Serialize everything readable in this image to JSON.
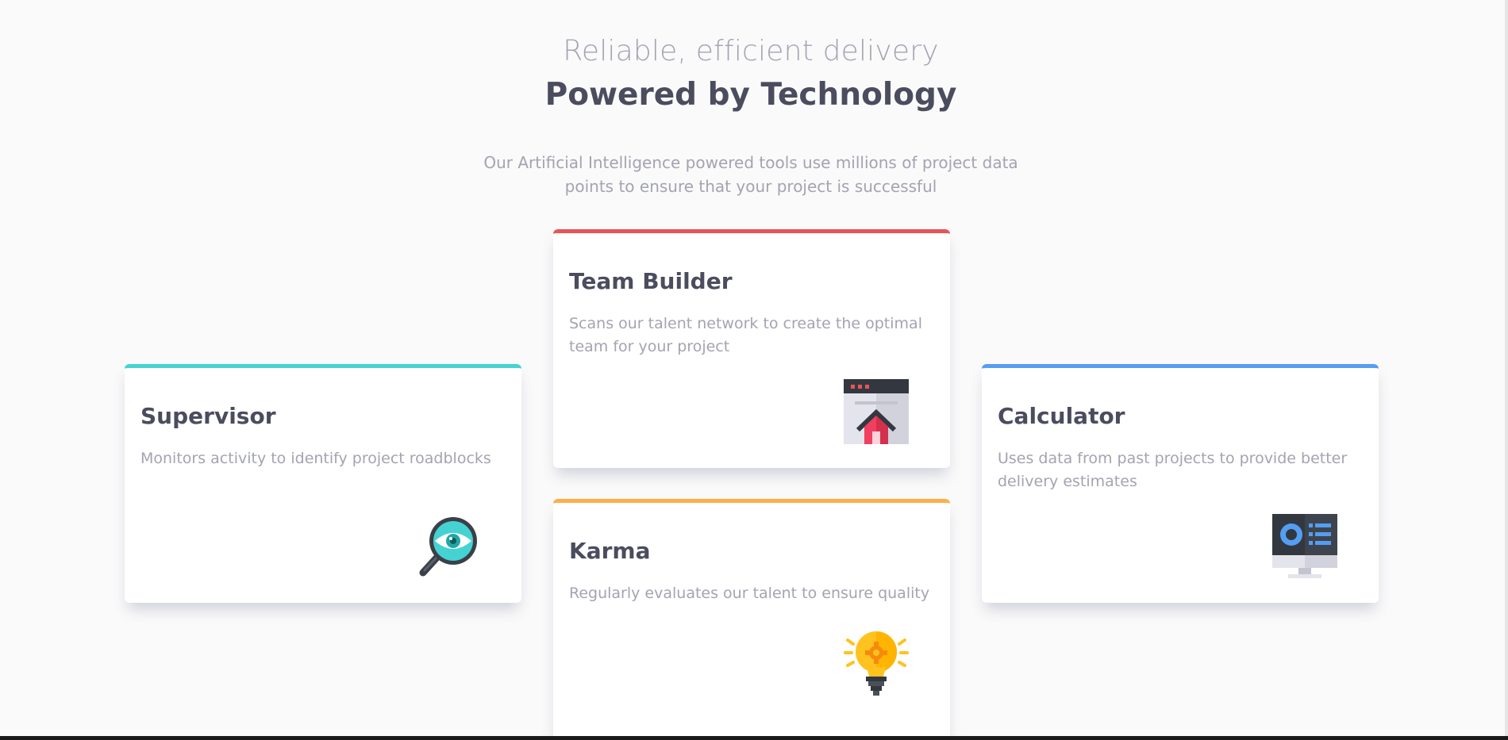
{
  "header": {
    "subtitle": "Reliable, efficient delivery",
    "title": "Powered by Technology",
    "intro": "Our Artificial Intelligence powered tools use millions of project data points to ensure that your project is successful"
  },
  "cards": {
    "supervisor": {
      "title": "Supervisor",
      "description": "Monitors activity to identify project roadblocks",
      "icon": "magnifier-eye-icon",
      "accent": "#44d3d2"
    },
    "team_builder": {
      "title": "Team Builder",
      "description": "Scans our talent network to create the optimal team for your project",
      "icon": "browser-house-icon",
      "accent": "#ea5454"
    },
    "karma": {
      "title": "Karma",
      "description": "Regularly evaluates our talent to ensure quality",
      "icon": "lightbulb-icon",
      "accent": "#fcaf4a"
    },
    "calculator": {
      "title": "Calculator",
      "description": "Uses data from past projects to provide better delivery estimates",
      "icon": "monitor-chart-icon",
      "accent": "#549ef2"
    }
  },
  "colors": {
    "background": "#fafafa",
    "heading": "#4b4c5e",
    "muted": "#a3a4b1"
  }
}
